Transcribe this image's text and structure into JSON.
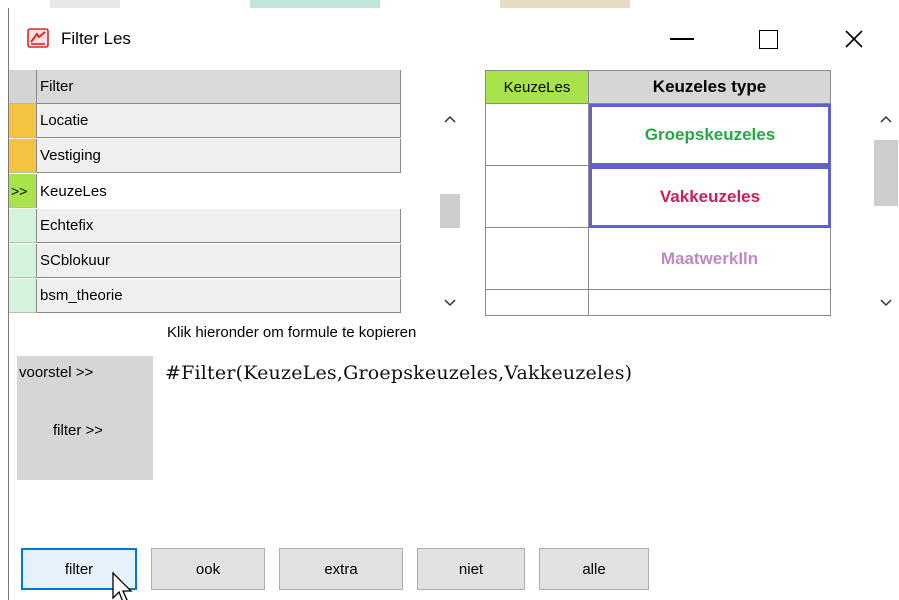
{
  "window": {
    "title": "Filter Les",
    "app_icon": "filter-app-icon"
  },
  "left_grid": {
    "header": "Filter",
    "rows": [
      {
        "indicator": "",
        "indicator_color": "#f5c342",
        "label": "Locatie",
        "bg": "#f0f0f0"
      },
      {
        "indicator": "",
        "indicator_color": "#f5c342",
        "label": "Vestiging",
        "bg": "#f0f0f0"
      },
      {
        "indicator": ">>",
        "indicator_color": "#a8e34b",
        "label": "KeuzeLes",
        "bg": "#ffffff"
      },
      {
        "indicator": "",
        "indicator_color": "#d4f5dc",
        "label": "Echtefix",
        "bg": "#f0f0f0"
      },
      {
        "indicator": "",
        "indicator_color": "#d4f5dc",
        "label": "SCblokuur",
        "bg": "#f0f0f0"
      },
      {
        "indicator": "",
        "indicator_color": "#d4f5dc",
        "label": "bsm_theorie",
        "bg": "#f0f0f0"
      }
    ]
  },
  "right_grid": {
    "header_a": "KeuzeLes",
    "header_b": "Keuzeles type",
    "rows": [
      {
        "label": "Groepskeuzeles",
        "color": "#22aa44",
        "selected": true
      },
      {
        "label": "Vakkeuzeles",
        "color": "#cc1f5a",
        "selected": true
      },
      {
        "label": "MaatwerkIln",
        "color": "#c08ac0",
        "selected": false
      },
      {
        "label": "",
        "color": "#000000",
        "selected": false
      }
    ]
  },
  "formula_section": {
    "hint": "Klik hieronder om formule te kopieren",
    "voorstel_label": "voorstel >>",
    "filter_label": "filter >>",
    "formula": "#Filter(KeuzeLes,Groepskeuzeles,Vakkeuzeles)"
  },
  "buttons": {
    "filter": "filter",
    "ook": "ook",
    "extra": "extra",
    "niet": "niet",
    "alle": "alle"
  },
  "scroll_arrows": {
    "up": "^",
    "down": "v"
  }
}
